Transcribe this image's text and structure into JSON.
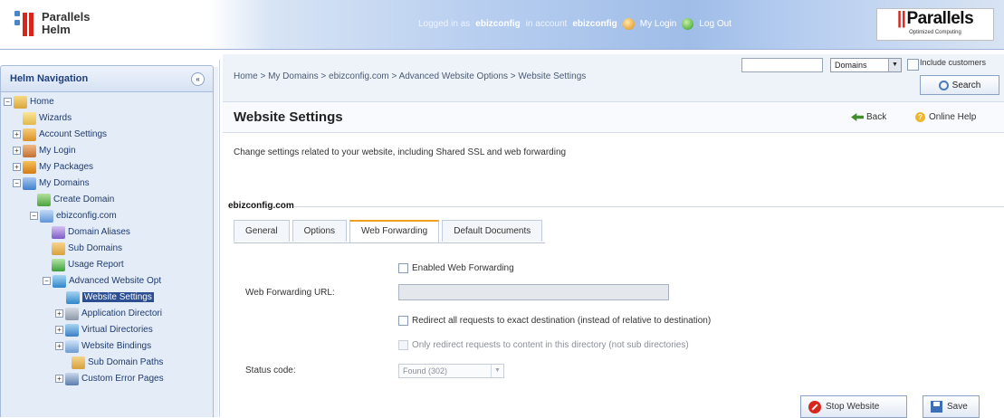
{
  "header": {
    "logo_line1": "Parallels",
    "logo_line2": "Helm",
    "logged_in_as_label": "Logged in as",
    "logged_in_user": "ebizconfig",
    "in_account_label": "in account",
    "account_name": "ebizconfig",
    "my_login_label": "My Login",
    "log_out_label": "Log Out",
    "brand_name": "Parallels",
    "brand_tagline": "Optimized Computing"
  },
  "sidebar": {
    "title": "Helm Navigation",
    "collapse_glyph": "«",
    "items": [
      {
        "label": "Home",
        "icon": "home-icon"
      },
      {
        "label": "Wizards",
        "icon": "wizard-icon"
      },
      {
        "label": "Account Settings",
        "icon": "account-icon"
      },
      {
        "label": "My Login",
        "icon": "login-icon"
      },
      {
        "label": "My Packages",
        "icon": "package-icon"
      },
      {
        "label": "My Domains",
        "icon": "domains-icon"
      },
      {
        "label": "Create Domain",
        "icon": "create-domain-icon"
      },
      {
        "label": "ebizconfig.com",
        "icon": "domain-icon"
      },
      {
        "label": "Domain Aliases",
        "icon": "alias-icon"
      },
      {
        "label": "Sub Domains",
        "icon": "subdomain-icon"
      },
      {
        "label": "Usage Report",
        "icon": "report-icon"
      },
      {
        "label": "Advanced Website Opt",
        "icon": "advanced-options-icon"
      },
      {
        "label": "Website Settings",
        "icon": "website-settings-icon"
      },
      {
        "label": "Application Directori",
        "icon": "application-icon"
      },
      {
        "label": "Virtual Directories",
        "icon": "virtual-directory-icon"
      },
      {
        "label": "Website Bindings",
        "icon": "binding-icon"
      },
      {
        "label": "Sub Domain Paths",
        "icon": "subdomain-path-icon"
      },
      {
        "label": "Custom Error Pages",
        "icon": "error-page-icon"
      }
    ]
  },
  "main": {
    "breadcrumb": "Home > My Domains > ebizconfig.com > Advanced Website Options > Website Settings",
    "search": {
      "value": "",
      "scope_selected": "Domains",
      "include_label": "Include customers",
      "button_label": "Search"
    },
    "title": "Website Settings",
    "back_label": "Back",
    "help_label": "Online Help",
    "description": "Change settings related to your website, including Shared SSL and web forwarding",
    "domain": "ebizconfig.com",
    "tabs": [
      "General",
      "Options",
      "Web Forwarding",
      "Default Documents"
    ],
    "active_tab": "Web Forwarding",
    "form": {
      "enabled_label": "Enabled Web Forwarding",
      "url_label": "Web Forwarding URL:",
      "url_value": "",
      "redirect_exact_label": "Redirect all requests to exact destination (instead of relative to destination)",
      "redirect_dir_label": "Only redirect requests to content in this directory (not sub directories)",
      "status_label": "Status code:",
      "status_value": "Found (302)"
    },
    "stop_button": "Stop Website",
    "save_button": "Save"
  }
}
